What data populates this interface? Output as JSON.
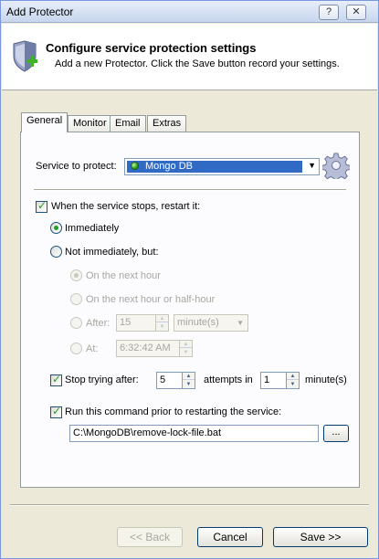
{
  "window": {
    "title": "Add Protector",
    "help_button": "?",
    "close_button": "✕"
  },
  "header": {
    "title": "Configure service protection settings",
    "subtitle": "Add a new Protector. Click the Save button record your settings.",
    "icon": "shield-add-icon"
  },
  "tabs": [
    {
      "label": "General",
      "active": true
    },
    {
      "label": "Monitor",
      "active": false
    },
    {
      "label": "Email",
      "active": false
    },
    {
      "label": "Extras",
      "active": false
    }
  ],
  "general": {
    "service_label": "Service to protect:",
    "service_value": "Mongo DB",
    "service_icon": "service-status-icon",
    "settings_icon": "gear-icon",
    "restart_label": "When the service stops, restart it:",
    "restart_checked": true,
    "immediately_label": "Immediately",
    "immediately_selected": true,
    "not_immediately_label": "Not immediately, but:",
    "next_hour_label": "On the next hour",
    "next_half_hour_label": "On the next hour or half-hour",
    "after_label": "After:",
    "after_value": "15",
    "after_unit": "minute(s)",
    "at_label": "At:",
    "at_value": "6:32:42 AM",
    "stop_trying_label": "Stop trying after:",
    "stop_trying_checked": true,
    "stop_trying_value": "5",
    "attempts_label": "attempts in",
    "attempts_value": "1",
    "minutes_label": "minute(s)",
    "run_command_label": "Run this command prior to restarting the service:",
    "run_command_checked": true,
    "command_value": "C:\\MongoDB\\remove-lock-file.bat",
    "browse_label": "..."
  },
  "buttons": {
    "back": "<< Back",
    "cancel": "Cancel",
    "save": "Save >>"
  },
  "colors": {
    "selection": "#316ac5",
    "check": "#21a121",
    "window_bg": "#ece9d8"
  }
}
